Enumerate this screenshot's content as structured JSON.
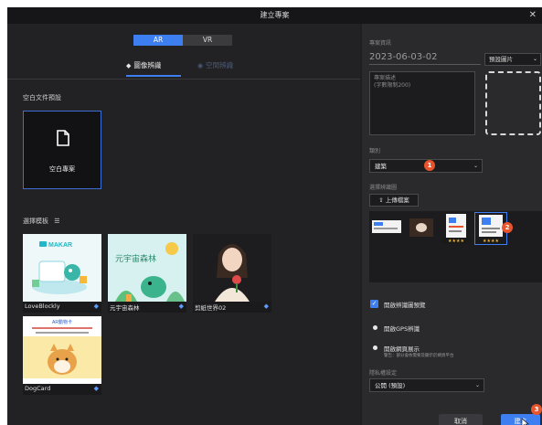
{
  "dialog": {
    "title": "建立專案",
    "close_glyph": "✕"
  },
  "platform": {
    "options": [
      "AR",
      "VR"
    ],
    "selected": "AR"
  },
  "modes": {
    "image_recognition": "圖像辨識",
    "spatial_recognition": "空間辨識",
    "selected": "圖像辨識"
  },
  "blank": {
    "section_label": "空白文件預設",
    "card_label": "空白專案",
    "icon": "document-icon"
  },
  "templates": {
    "section_label": "選擇模板",
    "items": [
      {
        "name": "LoveBlockly",
        "thumb_text": "MAKAR"
      },
      {
        "name": "元宇宙森林",
        "thumb_text": "元宇宙森林"
      },
      {
        "name": "剪紙世界02",
        "thumb_text": ""
      },
      {
        "name": "DogCard",
        "thumb_text": "AR動物卡"
      }
    ]
  },
  "project": {
    "info_label": "專案資訊",
    "title_value": "2023-06-03-02",
    "preset_image_label": "預設圖片",
    "description_placeholder": "專案描述\n(字數限制200)",
    "category_label": "類別",
    "category_value": "建築",
    "recognition_images_label": "選擇辨識圖",
    "upload_label": "上傳檔案",
    "stars": "★★★★"
  },
  "options": {
    "enable_preview": "開啟辨識圖預覽",
    "enable_gps": "開啟GPS辨識",
    "enable_web": "開啟網頁展示",
    "web_hint": "警告：部分會依需要及顯示於網頁平台"
  },
  "privacy": {
    "label": "隱私權設定",
    "value": "公開 (預設)"
  },
  "actions": {
    "cancel": "取消",
    "confirm": "建立"
  },
  "step_badges": [
    "1",
    "2",
    "3"
  ],
  "colors": {
    "accent": "#3d7ff0",
    "badge": "#e8542c"
  }
}
